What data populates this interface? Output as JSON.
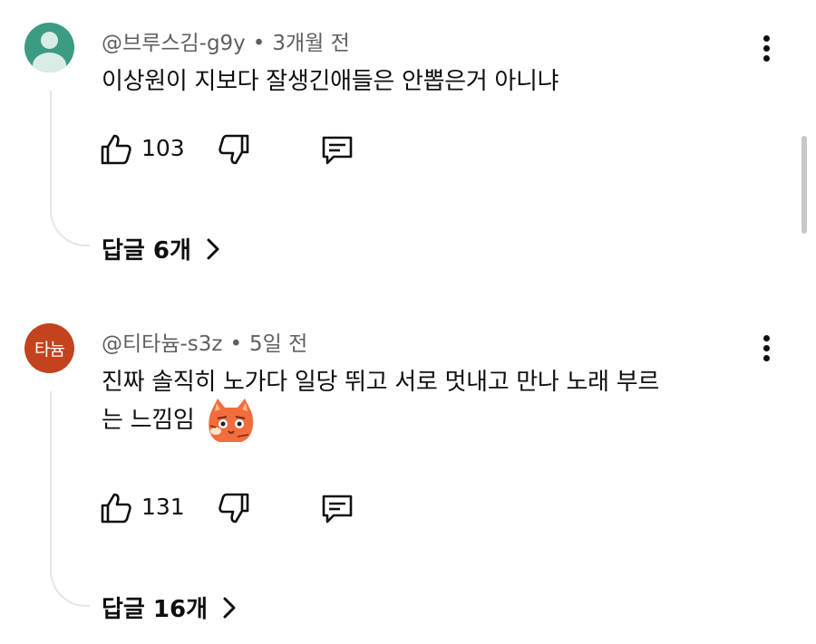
{
  "comments": [
    {
      "author": "@브루스김-g9y",
      "time": "3개월 전",
      "text": "이상원이 지보다 잘생긴애들은 안뽑은거 아니냐",
      "likes": "103",
      "replies": "답글 6개",
      "avatar_type": "default-person-icon",
      "avatar_color": "#3b9b83"
    },
    {
      "author": "@티타늄-s3z",
      "time": "5일 전",
      "text_line1": "진짜 솔직히 노가다  일당 뛰고 서로 멋내고 만나 노래 부르",
      "text_line2": "는 느낌임",
      "likes": "131",
      "replies": "답글 16개",
      "avatar_text": "타늄",
      "avatar_color": "#c2431e",
      "emoji": "cat-emoji-icon"
    }
  ],
  "separator": "•",
  "icons": [
    "thumbs-up-icon",
    "thumbs-down-icon",
    "reply-icon",
    "more-icon",
    "chevron-right-icon"
  ]
}
